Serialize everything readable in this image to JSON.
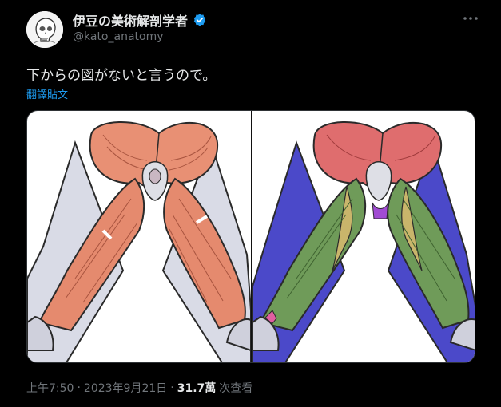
{
  "author": {
    "display_name": "伊豆の美術解剖学者",
    "handle": "@kato_anatomy",
    "verified": true
  },
  "tweet": {
    "text": "下からの図がないと言うので。",
    "translate_label": "翻譯貼文"
  },
  "meta": {
    "time": "上午7:50",
    "sep1": "·",
    "date": "2023年9月21日",
    "sep2": "·",
    "views_count": "31.7萬",
    "views_label": "次查看"
  },
  "colors": {
    "accent": "#1d9bf0",
    "muted": "#71767b"
  },
  "icons": [
    "verified-badge-icon",
    "more-options-icon"
  ]
}
